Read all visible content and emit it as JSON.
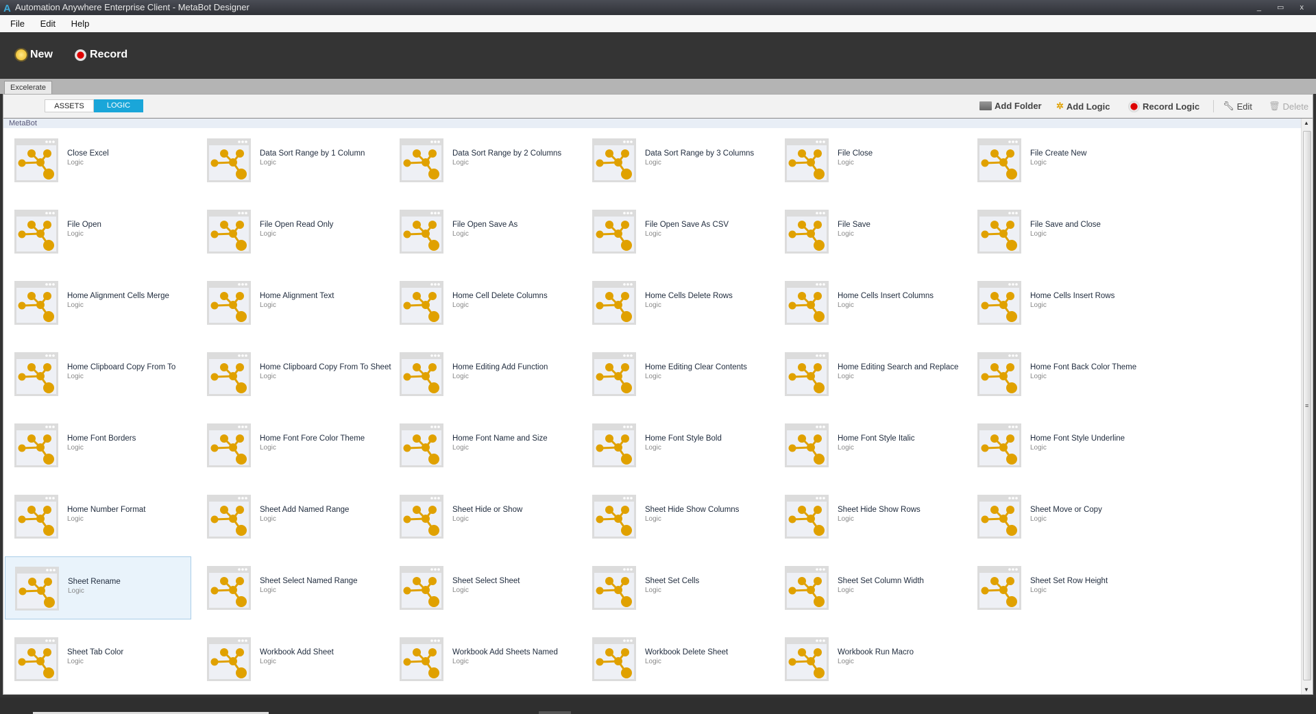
{
  "window": {
    "title": "Automation Anywhere Enterprise Client - MetaBot Designer",
    "controls": "_ ▭ x"
  },
  "menu": [
    "File",
    "Edit",
    "Help"
  ],
  "toolbar": {
    "new_label": "New",
    "record_label": "Record"
  },
  "tab": "Excelerate",
  "segments": {
    "assets": "ASSETS",
    "logic": "LOGIC"
  },
  "actions": {
    "add_folder": "Add Folder",
    "add_logic": "Add Logic",
    "record_logic": "Record Logic",
    "edit": "Edit",
    "delete": "Delete"
  },
  "breadcrumb": "MetaBot",
  "colors": {
    "accent": "#1aa6d9",
    "logic_icon": "#e0a100",
    "selected": "#e9f3fb"
  },
  "selected_item": "Sheet Rename",
  "item_type": "Logic",
  "items": [
    "Close Excel",
    "Data Sort Range by 1 Column",
    "Data Sort Range by 2 Columns",
    "Data Sort Range by 3 Columns",
    "File Close",
    "File Create New",
    "File Open",
    "File Open Read Only",
    "File Open Save As",
    "File Open Save As CSV",
    "File Save",
    "File Save and Close",
    "Home Alignment Cells Merge",
    "Home Alignment Text",
    "Home Cell Delete Columns",
    "Home Cells Delete Rows",
    "Home Cells Insert Columns",
    "Home Cells Insert Rows",
    "Home Clipboard Copy From To",
    "Home Clipboard Copy From To Sheet",
    "Home Editing Add Function",
    "Home Editing Clear Contents",
    "Home Editing Search and Replace",
    "Home Font Back Color Theme",
    "Home Font Borders",
    "Home Font Fore Color Theme",
    "Home Font Name and Size",
    "Home Font Style Bold",
    "Home Font Style Italic",
    "Home Font Style Underline",
    "Home Number Format",
    "Sheet Add Named Range",
    "Sheet Hide or Show",
    "Sheet Hide Show Columns",
    "Sheet Hide Show Rows",
    "Sheet Move or Copy",
    "Sheet Rename",
    "Sheet Select Named Range",
    "Sheet Select Sheet",
    "Sheet Set Cells",
    "Sheet Set Column Width",
    "Sheet Set Row Height",
    "Sheet Tab Color",
    "Workbook Add Sheet",
    "Workbook Add Sheets Named",
    "Workbook Delete Sheet",
    "Workbook Run Macro"
  ]
}
